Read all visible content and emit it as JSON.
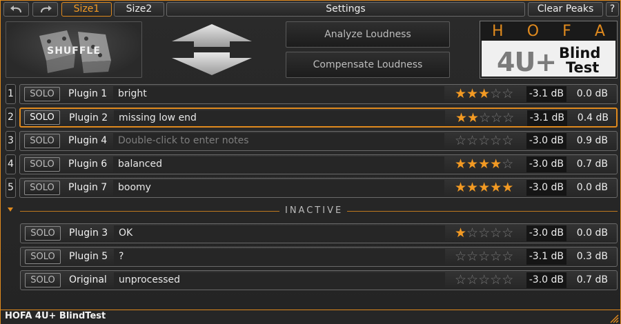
{
  "toolbar": {
    "undo_icon": "undo-icon",
    "redo_icon": "redo-icon",
    "size1": "Size1",
    "size2": "Size2",
    "settings": "Settings",
    "clear_peaks": "Clear Peaks",
    "help": "?"
  },
  "header": {
    "shuffle_label": "SHUFFLE",
    "analyze": "Analyze Loudness",
    "compensate": "Compensate Loudness",
    "logo": {
      "hofa": [
        "H",
        "O",
        "F",
        "A"
      ],
      "product": "4U+",
      "line1": "Blind",
      "line2": "Test"
    }
  },
  "active_rows": [
    {
      "index": "1",
      "solo": "SOLO",
      "plugin": "Plugin 1",
      "notes": "bright",
      "placeholder": false,
      "rating": 3,
      "peak": "-3.1 dB",
      "comp": "0.0 dB",
      "selected": false
    },
    {
      "index": "2",
      "solo": "SOLO",
      "plugin": "Plugin 2",
      "notes": "missing low end",
      "placeholder": false,
      "rating": 2,
      "peak": "-3.1 dB",
      "comp": "0.4 dB",
      "selected": true
    },
    {
      "index": "3",
      "solo": "SOLO",
      "plugin": "Plugin 4",
      "notes": "Double-click to enter notes",
      "placeholder": true,
      "rating": 0,
      "peak": "-3.0 dB",
      "comp": "0.9 dB",
      "selected": false
    },
    {
      "index": "4",
      "solo": "SOLO",
      "plugin": "Plugin 6",
      "notes": "balanced",
      "placeholder": false,
      "rating": 4,
      "peak": "-3.0 dB",
      "comp": "0.7 dB",
      "selected": false
    },
    {
      "index": "5",
      "solo": "SOLO",
      "plugin": "Plugin 7",
      "notes": "boomy",
      "placeholder": false,
      "rating": 5,
      "peak": "-3.0 dB",
      "comp": "0.0 dB",
      "selected": false
    }
  ],
  "inactive_label": "INACTIVE",
  "inactive_rows": [
    {
      "solo": "SOLO",
      "plugin": "Plugin 3",
      "notes": "OK",
      "rating": 1,
      "peak": "-3.0 dB",
      "comp": "0.0 dB"
    },
    {
      "solo": "SOLO",
      "plugin": "Plugin 5",
      "notes": "?",
      "rating": 0,
      "peak": "-3.1 dB",
      "comp": "0.3 dB"
    },
    {
      "solo": "SOLO",
      "plugin": "Original",
      "notes": "unprocessed",
      "rating": 0,
      "peak": "-3.0 dB",
      "comp": "0.7 dB"
    }
  ],
  "rating_max": 5,
  "footer": {
    "title": "HOFA 4U+ BlindTest"
  },
  "colors": {
    "accent": "#e08a1e",
    "star_on": "#f39a23",
    "star_off": "#777777"
  }
}
